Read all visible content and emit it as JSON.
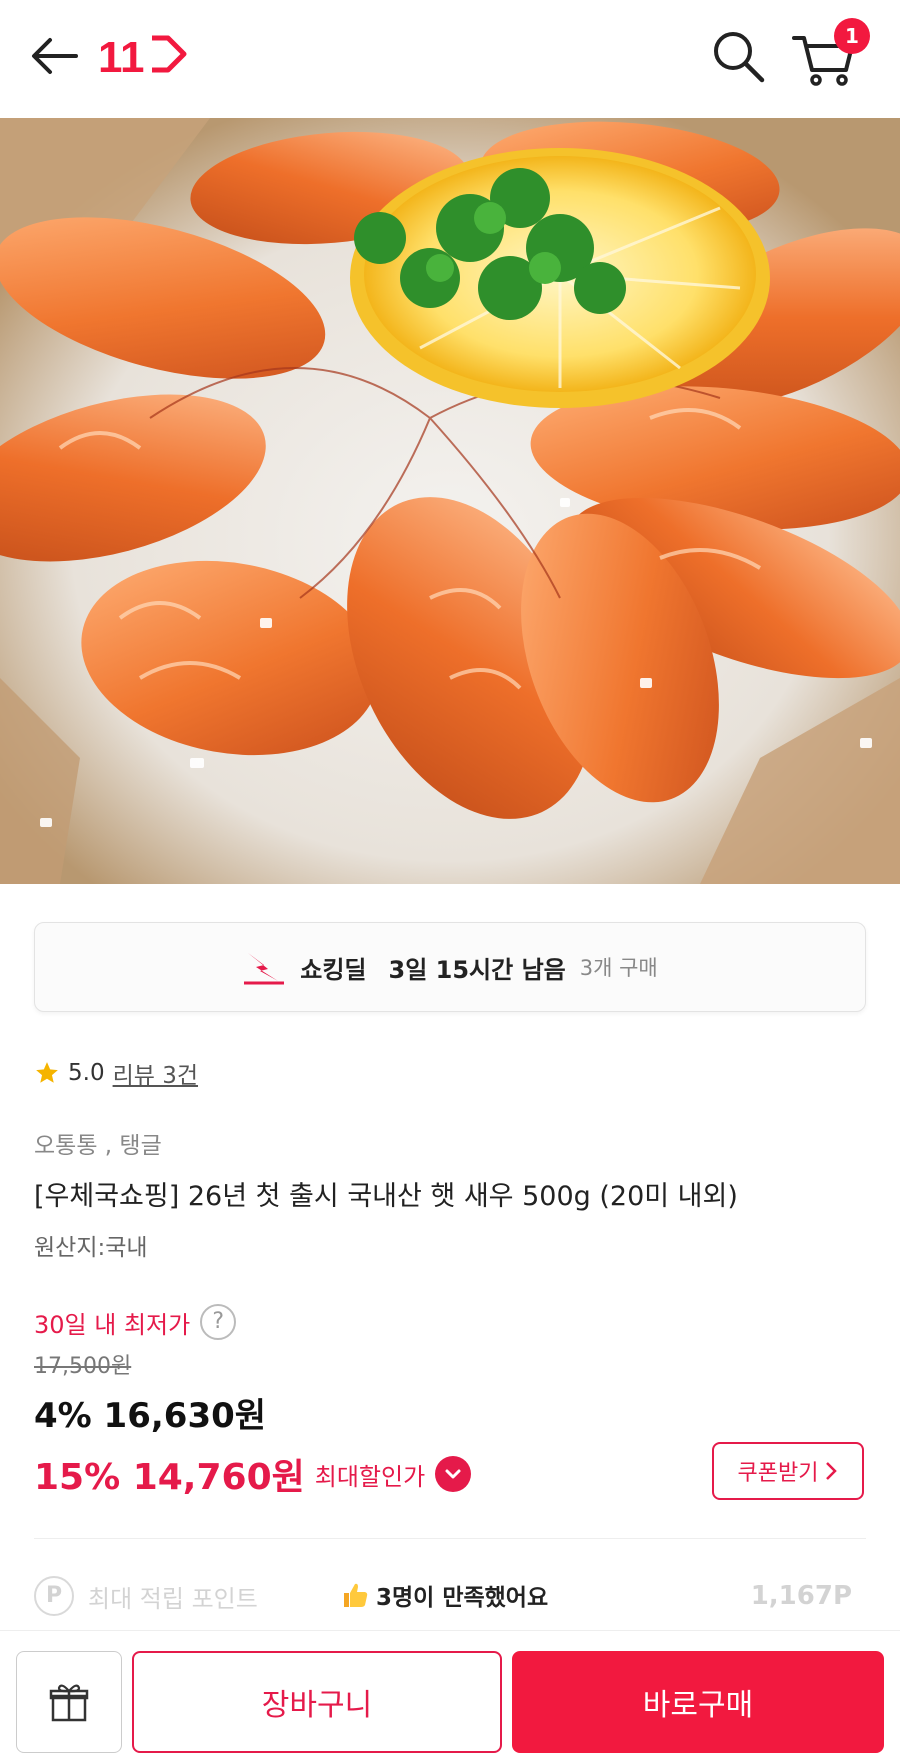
{
  "header": {
    "logo_text": "11",
    "cart_count": "1"
  },
  "deal": {
    "name": "쇼킹딜",
    "time_left": "3일 15시간 남음",
    "purchase_count": "3개 구매"
  },
  "rating": {
    "score": "5.0",
    "review_link": "리뷰 3건"
  },
  "product": {
    "brand": "오통통 , 탱글",
    "title": "[우체국쇼핑] 26년 첫 출시 국내산 햇 새우 500g (20미 내외)",
    "origin": "원산지:국내"
  },
  "price": {
    "lowest_label": "30일 내 최저가",
    "help_symbol": "?",
    "original": "17,500원",
    "sale": "4% 16,630원",
    "max_discount": "15% 14,760원",
    "max_label": "최대할인가"
  },
  "coupon": {
    "label": "쿠폰받기"
  },
  "points": {
    "icon_letter": "P",
    "label": "최대 적립 포인트",
    "value": "1,167P"
  },
  "satisfaction": {
    "text": "3명이 만족했어요"
  },
  "bottom": {
    "cart_label": "장바구니",
    "buy_label": "바로구매"
  },
  "colors": {
    "brand_red": "#f2193f",
    "price_red": "#e51a4a"
  }
}
